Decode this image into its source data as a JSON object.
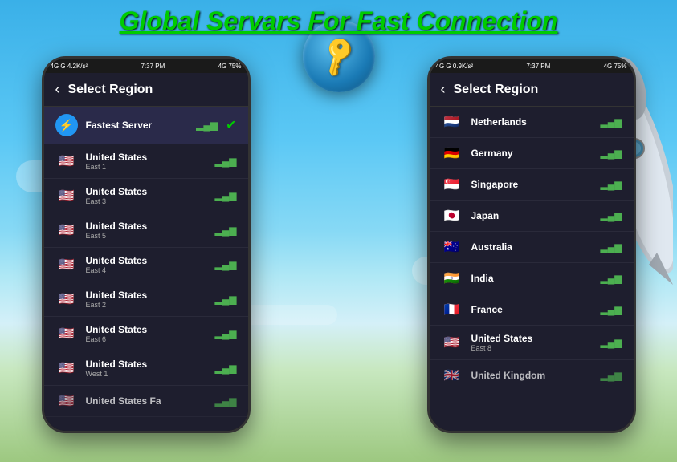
{
  "title": "Global Servars For Fast Connection",
  "phone_left": {
    "status_bar": {
      "left": "4G  G  4.2K/s²",
      "time": "7:37 PM",
      "right": "4G 75%"
    },
    "header": {
      "back": "‹",
      "title": "Select Region"
    },
    "items": [
      {
        "id": "fastest",
        "name": "Fastest Server",
        "sub": "",
        "flag": "⚡",
        "flag_type": "fastest",
        "active": true
      },
      {
        "id": "us-east1",
        "name": "United States",
        "sub": "East 1",
        "flag": "🇺🇸",
        "flag_type": "us",
        "active": false
      },
      {
        "id": "us-east3",
        "name": "United States",
        "sub": "East 3",
        "flag": "🇺🇸",
        "flag_type": "us",
        "active": false
      },
      {
        "id": "us-east5",
        "name": "United States",
        "sub": "East 5",
        "flag": "🇺🇸",
        "flag_type": "us",
        "active": false
      },
      {
        "id": "us-east4",
        "name": "United States",
        "sub": "East 4",
        "flag": "🇺🇸",
        "flag_type": "us",
        "active": false
      },
      {
        "id": "us-east2",
        "name": "United States",
        "sub": "East 2",
        "flag": "🇺🇸",
        "flag_type": "us",
        "active": false
      },
      {
        "id": "us-east6",
        "name": "United States",
        "sub": "East 6",
        "flag": "🇺🇸",
        "flag_type": "us",
        "active": false
      },
      {
        "id": "us-west1",
        "name": "United States",
        "sub": "West 1",
        "flag": "🇺🇸",
        "flag_type": "us",
        "active": false
      },
      {
        "id": "us-fa",
        "name": "United States Fa",
        "sub": "",
        "flag": "🇺🇸",
        "flag_type": "us",
        "active": false
      }
    ]
  },
  "phone_right": {
    "status_bar": {
      "left": "4G  G  0.9K/s²",
      "time": "7:37 PM",
      "right": "4G 75%"
    },
    "header": {
      "back": "‹",
      "title": "Select Region"
    },
    "items": [
      {
        "id": "nl",
        "name": "Netherlands",
        "sub": "",
        "flag": "🇳🇱",
        "flag_type": "nl",
        "active": false
      },
      {
        "id": "de",
        "name": "Germany",
        "sub": "",
        "flag": "🇩🇪",
        "flag_type": "de",
        "active": false
      },
      {
        "id": "sg",
        "name": "Singapore",
        "sub": "",
        "flag": "🇸🇬",
        "flag_type": "sg",
        "active": false
      },
      {
        "id": "jp",
        "name": "Japan",
        "sub": "",
        "flag": "🇯🇵",
        "flag_type": "jp",
        "active": false
      },
      {
        "id": "au",
        "name": "Australia",
        "sub": "",
        "flag": "🇦🇺",
        "flag_type": "au",
        "active": false
      },
      {
        "id": "in",
        "name": "India",
        "sub": "",
        "flag": "🇮🇳",
        "flag_type": "in",
        "active": false
      },
      {
        "id": "fr",
        "name": "France",
        "sub": "",
        "flag": "🇫🇷",
        "flag_type": "fr",
        "active": false
      },
      {
        "id": "us-east8",
        "name": "United States",
        "sub": "East 8",
        "flag": "🇺🇸",
        "flag_type": "us",
        "active": false
      },
      {
        "id": "gb",
        "name": "United Kingdom",
        "sub": "",
        "flag": "🇬🇧",
        "flag_type": "gb",
        "active": false
      }
    ]
  },
  "key_button": {
    "label": "🔑"
  }
}
